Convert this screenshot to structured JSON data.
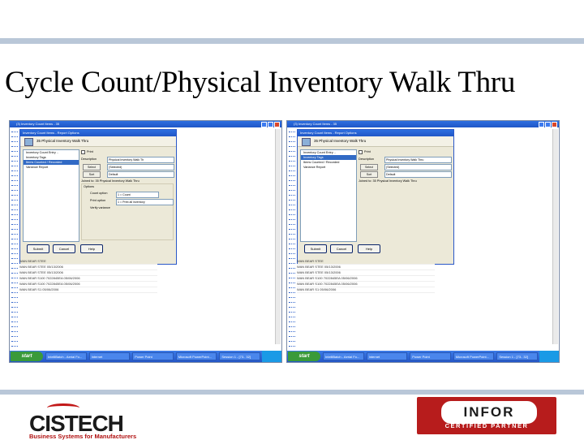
{
  "slide": {
    "title": "Cycle Count/Physical Inventory Walk Thru"
  },
  "colors": {
    "accent_bar": "#b9c7d8",
    "xp_blue": "#2456c8",
    "infor_red": "#b71c1c",
    "cistech_red": "#b01010"
  },
  "screens": [
    {
      "window_title": "(3) Inventory Count Items - 35",
      "dialog_title": "Inventory Count Items - Report Options",
      "dialog_header": "35 Physical Inventory Walk Thru",
      "tree_items": [
        "Inventory Count Entry ..",
        "Inventory Tags",
        "Items Counted / Recorded",
        "Variance Report"
      ],
      "fields": {
        "desc_label": "Description",
        "desc_value": "Physical Inventory Walk Th",
        "select_btn": "Select",
        "select_value": "(Selected)",
        "sort_btn": "Sort",
        "sort_value": "Default",
        "joined_label": "Joined to: 35 Physical Inventory Walk Thru",
        "options_label": "Options",
        "count_label": "Count option",
        "count_value": "1 = Count",
        "print_label": "Print option",
        "print_value": "1 = Print all inventory",
        "verify_label": "Verify variance"
      },
      "buttons": {
        "submit": "Submit",
        "cancel": "Cancel",
        "help": "Help"
      },
      "grid_rows": [
        "WAN  BEAR  STEE",
        "WAN  BEAR  STEE    05/13/2006",
        "WAN  BEAR  STEE    05/13/2006",
        "WAN  BEAR  S100  7022845EA 05/06/2006",
        "WAN  BEAR  S100  7022845EA 05/06/2006",
        "WAN  BEAR  S1      05/06/2006"
      ],
      "taskbar": [
        "start",
        "IntelliBatch - Aerial Fo...",
        "Internet",
        "Power Point",
        "Microsoft PowerPoint...",
        "Session 1 - [73.. 32]"
      ]
    },
    {
      "window_title": "(3) Inventory Count Items - 35",
      "dialog_title": "Inventory Count Items - Report Options",
      "dialog_header": "35 Physical Inventory Walk Thru",
      "tree_items": [
        "Inventory Count Entry ..",
        "Inventory Tags",
        "Items Counted / Recorded",
        "Variance Report"
      ],
      "fields": {
        "desc_label": "Description",
        "desc_value": "Physical Inventory Walk Thru",
        "select_btn": "Select",
        "select_value": "(Selected)",
        "sort_btn": "Sort",
        "sort_value": "Default",
        "joined_label": "Joined to: 35 Physical Inventory Walk Thru",
        "options_label": "",
        "count_label": "",
        "count_value": "",
        "print_label": "",
        "print_value": "",
        "verify_label": ""
      },
      "buttons": {
        "submit": "Submit",
        "cancel": "Cancel",
        "help": "Help"
      },
      "grid_rows": [
        "WAN  BEAR  STEE",
        "WAN  BEAR  STEE    05/13/2006",
        "WAN  BEAR  STEE    05/13/2006",
        "WAN  BEAR  S100  7022845EA 05/06/2006",
        "WAN  BEAR  S100  7022845EA 05/06/2006",
        "WAN  BEAR  S1      05/06/2006"
      ],
      "taskbar": [
        "start",
        "IntelliBatch - Aerial Fo...",
        "Internet",
        "Power Point",
        "Microsoft PowerPoint...",
        "Session 1 - [73.. 32]"
      ]
    }
  ],
  "footer": {
    "cistech_name": "CISTECH",
    "cistech_tagline": "Business Systems for Manufacturers",
    "infor_word": "INFOR",
    "infor_cert": "CERTIFIED PARTNER"
  }
}
